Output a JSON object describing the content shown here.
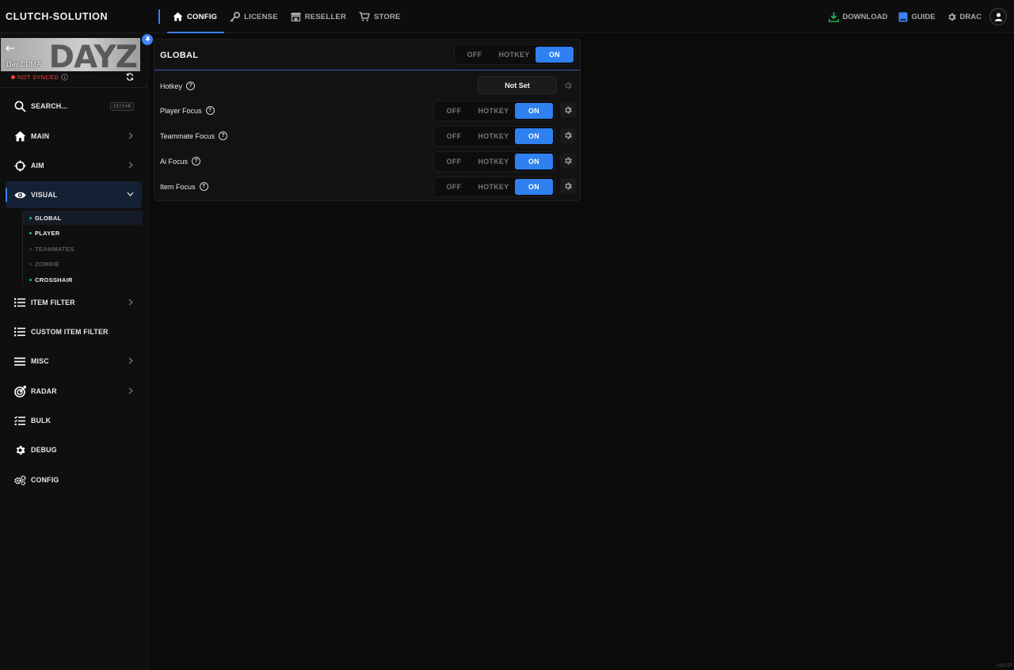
{
  "app": {
    "brand": "CLUTCH-SOLUTION",
    "version": "v3.0.57"
  },
  "topnav": {
    "tabs": [
      {
        "label": "CONFIG",
        "icon": "home-icon",
        "active": true
      },
      {
        "label": "LICENSE",
        "icon": "key-icon",
        "active": false
      },
      {
        "label": "RESELLER",
        "icon": "store-icon",
        "active": false
      },
      {
        "label": "STORE",
        "icon": "cart-icon",
        "active": false
      }
    ],
    "right": {
      "download_label": "DOWNLOAD",
      "guide_label": "GUIDE",
      "user_label": "DRAC"
    }
  },
  "sidebar": {
    "game_name": "DayZ DMA",
    "banner_text": "DAYZ",
    "sync_status": "NOT SYNCED",
    "search_label": "SEARCH...",
    "search_shortcut": "Ctrl+K",
    "items": [
      {
        "label": "MAIN",
        "icon": "home-icon",
        "has_chevron": true
      },
      {
        "label": "AIM",
        "icon": "crosshair-icon",
        "has_chevron": true
      },
      {
        "label": "VISUAL",
        "icon": "eye-icon",
        "has_chevron": true,
        "expanded": true
      },
      {
        "label": "ITEM FILTER",
        "icon": "list-icon",
        "has_chevron": true
      },
      {
        "label": "CUSTOM ITEM FILTER",
        "icon": "list-icon",
        "has_chevron": false
      },
      {
        "label": "MISC",
        "icon": "menu-icon",
        "has_chevron": true
      },
      {
        "label": "RADAR",
        "icon": "radar-icon",
        "has_chevron": true
      },
      {
        "label": "BULK",
        "icon": "checklist-icon",
        "has_chevron": false
      },
      {
        "label": "DEBUG",
        "icon": "gear-icon",
        "has_chevron": false
      },
      {
        "label": "CONFIG",
        "icon": "gears-icon",
        "has_chevron": false
      }
    ],
    "visual_sub": [
      {
        "label": "GLOBAL",
        "enabled": true,
        "selected": true
      },
      {
        "label": "PLAYER",
        "enabled": true,
        "selected": false
      },
      {
        "label": "TEAMMATES",
        "enabled": false,
        "selected": false
      },
      {
        "label": "ZOMBIE",
        "enabled": false,
        "selected": false
      },
      {
        "label": "CROSSHAIR",
        "enabled": true,
        "selected": false
      }
    ]
  },
  "panel": {
    "title": "GLOBAL",
    "mode_options": [
      "OFF",
      "HOTKEY",
      "ON"
    ],
    "mode_selected": "ON",
    "hotkey_row": {
      "label": "Hotkey",
      "value": "Not Set"
    },
    "rows": [
      {
        "label": "Player Focus",
        "selected": "ON"
      },
      {
        "label": "Teammate Focus",
        "selected": "ON"
      },
      {
        "label": "Ai Focus",
        "selected": "ON"
      },
      {
        "label": "Item Focus",
        "selected": "ON"
      }
    ]
  },
  "colors": {
    "accent": "#2f80f0",
    "danger": "#ef4444",
    "enabled_dot": "#22c55e",
    "download_icon": "#22a34a",
    "guide_icon": "#3b82f6"
  }
}
